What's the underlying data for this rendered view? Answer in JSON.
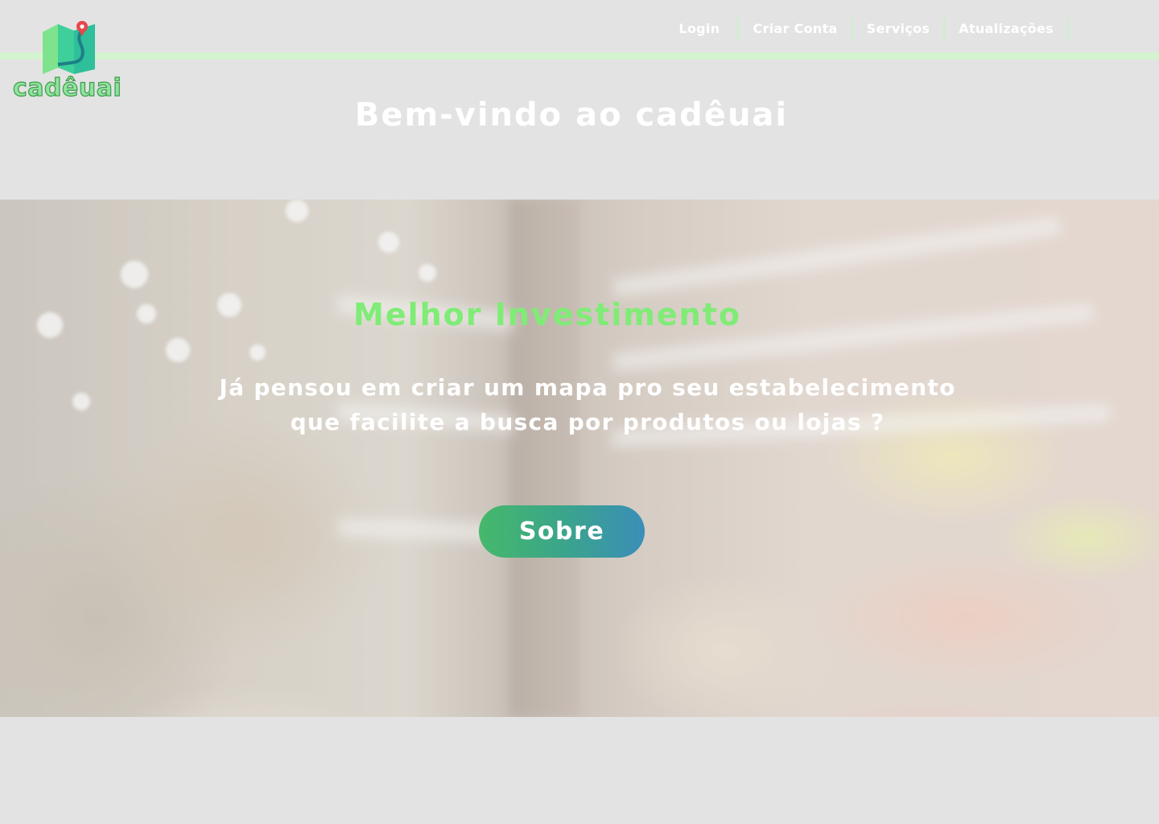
{
  "header": {
    "nav": [
      "Login",
      "Criar Conta",
      "Serviços",
      "Atualizações"
    ],
    "logo_text": "cadêuai"
  },
  "welcome": "Bem-vindo ao cadêuai",
  "hero": {
    "title": "Melhor Investimento",
    "text_line1": "Já pensou em criar um mapa pro seu estabelecimento",
    "text_line2": "que facilite a busca por produtos ou lojas ?",
    "button_label": "Sobre"
  },
  "colors": {
    "accent_green": "#7fec76",
    "header_line": "#d4f4cf",
    "button_gradient_start": "#46b86b",
    "button_gradient_end": "#3a8eb8"
  }
}
